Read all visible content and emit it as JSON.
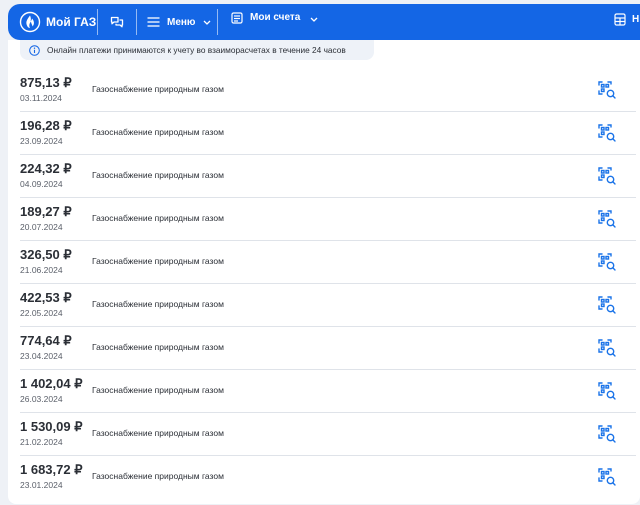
{
  "brand": {
    "name": "Мой ГАЗ"
  },
  "nav": {
    "menu_label": "Меню",
    "accounts_label": "Мои счета",
    "right_label": "Н"
  },
  "notice": {
    "text": "Онлайн платежи принимаются к учету во взаиморасчетах в течение 24 часов"
  },
  "colors": {
    "primary": "#1466e5",
    "qr_icon": "#1a73e8"
  },
  "icons": {
    "logo": "flame-logo-icon",
    "chat": "chat-icon",
    "menu": "hamburger-icon",
    "accounts": "accounts-icon",
    "dropdown": "chevron-down-icon",
    "info": "info-icon",
    "receipt": "qr-receipt-icon"
  },
  "payments": [
    {
      "amount": "875,13 ₽",
      "date": "03.11.2024",
      "service": "Газоснабжение природным газом"
    },
    {
      "amount": "196,28 ₽",
      "date": "23.09.2024",
      "service": "Газоснабжение природным газом"
    },
    {
      "amount": "224,32 ₽",
      "date": "04.09.2024",
      "service": "Газоснабжение природным газом"
    },
    {
      "amount": "189,27 ₽",
      "date": "20.07.2024",
      "service": "Газоснабжение природным газом"
    },
    {
      "amount": "326,50 ₽",
      "date": "21.06.2024",
      "service": "Газоснабжение природным газом"
    },
    {
      "amount": "422,53 ₽",
      "date": "22.05.2024",
      "service": "Газоснабжение природным газом"
    },
    {
      "amount": "774,64 ₽",
      "date": "23.04.2024",
      "service": "Газоснабжение природным газом"
    },
    {
      "amount": "1 402,04 ₽",
      "date": "26.03.2024",
      "service": "Газоснабжение природным газом"
    },
    {
      "amount": "1 530,09 ₽",
      "date": "21.02.2024",
      "service": "Газоснабжение природным газом"
    },
    {
      "amount": "1 683,72 ₽",
      "date": "23.01.2024",
      "service": "Газоснабжение природным газом"
    }
  ]
}
